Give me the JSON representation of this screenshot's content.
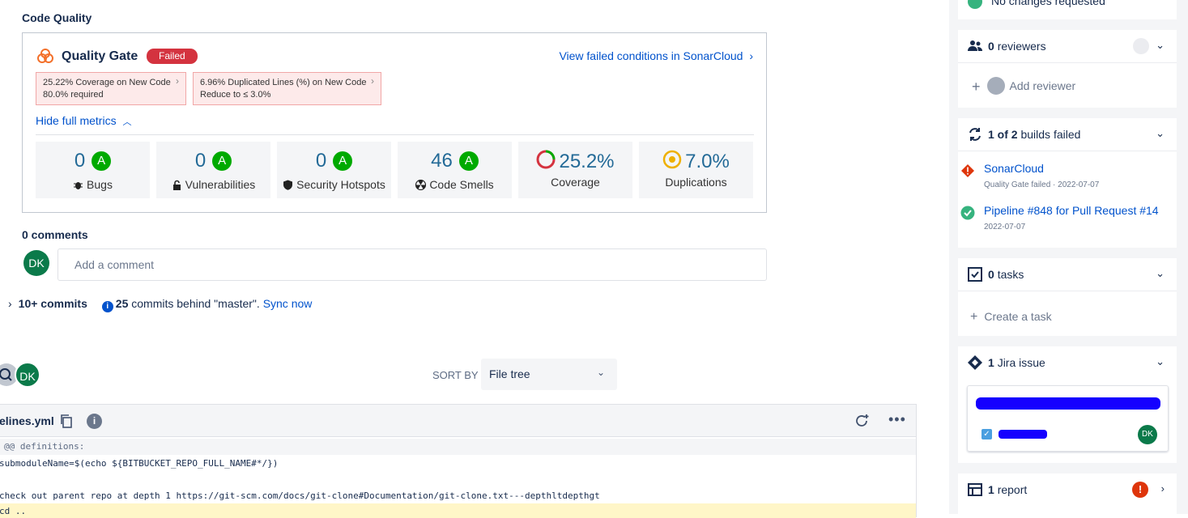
{
  "code_quality": {
    "title": "Code Quality",
    "gate_title": "Quality Gate",
    "gate_status": "Failed",
    "view_failed": "View failed conditions in SonarCloud",
    "conditions": [
      {
        "line1": "25.22% Coverage on New Code",
        "line2": "80.0% required"
      },
      {
        "line1": "6.96% Duplicated Lines (%) on New Code",
        "line2": "Reduce to ≤ 3.0%"
      }
    ],
    "hide_metrics": "Hide full metrics",
    "metrics": [
      {
        "value": "0",
        "grade": "A",
        "label": "Bugs"
      },
      {
        "value": "0",
        "grade": "A",
        "label": "Vulnerabilities"
      },
      {
        "value": "0",
        "grade": "A",
        "label": "Security Hotspots"
      },
      {
        "value": "46",
        "grade": "A",
        "label": "Code Smells"
      },
      {
        "value": "25.2%",
        "label": "Coverage"
      },
      {
        "value": "7.0%",
        "label": "Duplications"
      }
    ],
    "colors": {
      "failed": "#d4333f",
      "grade_a": "#00aa00",
      "metric_value": "#236a97"
    }
  },
  "comments": {
    "count_label": "0 comments",
    "avatar_initials": "DK",
    "placeholder": "Add a comment"
  },
  "commits": {
    "count_label": "10+ commits",
    "behind_count": "25",
    "behind_text": "commits behind \"master\".",
    "sync_label": "Sync now"
  },
  "file_list": {
    "avatar_initials": "DK",
    "sort_label": "SORT BY",
    "sort_value": "File tree"
  },
  "diff": {
    "filename": "elines.yml",
    "info_icon": "i",
    "hunk": "@@ definitions:",
    "lines": [
      "submoduleName=$(echo ${BITBUCKET_REPO_FULL_NAME#*/})",
      "check out parent repo at depth 1 https://git-scm.com/docs/git-clone#Documentation/git-clone.txt---depthltdepthgt",
      "cd .."
    ]
  },
  "sidebar": {
    "approval_status": "No changes requested",
    "reviewers": {
      "count": "0",
      "label": "reviewers",
      "add_label": "Add reviewer"
    },
    "builds": {
      "count": "1 of 2",
      "label": "builds failed",
      "items": [
        {
          "name": "SonarCloud",
          "meta": "Quality Gate failed  ·  2022-07-07",
          "status": "failed"
        },
        {
          "name": "Pipeline #848 for Pull Request #14",
          "meta": "2022-07-07",
          "status": "success"
        }
      ]
    },
    "tasks": {
      "count": "0",
      "label": "tasks",
      "create_label": "Create a task"
    },
    "jira": {
      "count": "1",
      "label": "Jira issue",
      "avatar_initials": "DK"
    },
    "report": {
      "count": "1",
      "label": "report",
      "alert": "!"
    }
  }
}
